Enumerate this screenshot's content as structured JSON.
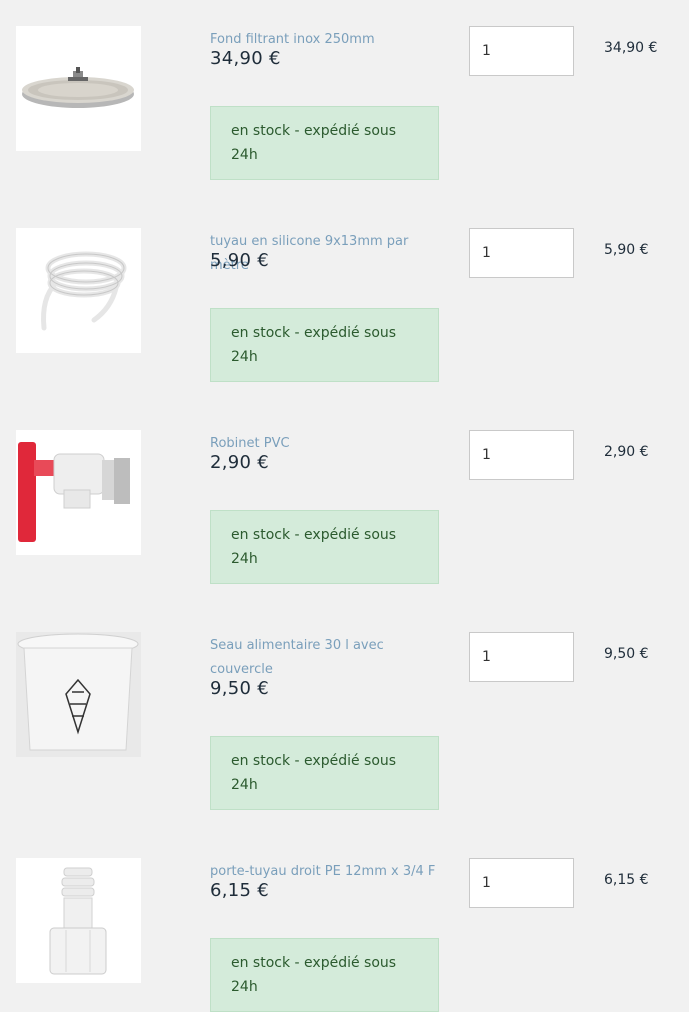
{
  "cart": {
    "items": [
      {
        "name": "Fond filtrant inox 250mm",
        "unit_price": "34,90 €",
        "stock": "en stock - expédié sous 24h",
        "quantity": "1",
        "total": "34,90 €",
        "icon": "filter-plate-image"
      },
      {
        "name": "tuyau en silicone 9x13mm par mètre",
        "unit_price": "5,90 €",
        "stock": "en stock - expédié sous 24h",
        "quantity": "1",
        "total": "5,90 €",
        "icon": "silicone-hose-image"
      },
      {
        "name": "Robinet PVC",
        "unit_price": "2,90 €",
        "stock": "en stock - expédié sous 24h",
        "quantity": "1",
        "total": "2,90 €",
        "icon": "tap-image"
      },
      {
        "name": "Seau alimentaire 30 l avec couvercle",
        "unit_price": "9,50 €",
        "stock": "en stock - expédié sous 24h",
        "quantity": "1",
        "total": "9,50 €",
        "icon": "bucket-image"
      },
      {
        "name": "porte-tuyau droit PE 12mm x 3/4 F",
        "unit_price": "6,15 €",
        "stock": "en stock - expédié sous 24h",
        "quantity": "1",
        "total": "6,15 €",
        "icon": "hose-barb-image"
      }
    ]
  },
  "colors": {
    "background": "#f1f1f1",
    "product_link": "#7a9fbb",
    "stock_bg": "#d4ebda",
    "stock_text": "#2b5a2e",
    "price_text": "#1f2d3a"
  }
}
